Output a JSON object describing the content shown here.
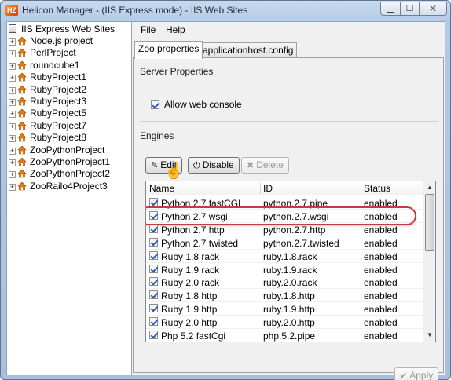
{
  "window": {
    "title": "Helicon Manager - (IIS Express mode) - IIS Web Sites",
    "app_icon_text": "HZ",
    "min_glyph": "▁",
    "max_glyph": "☐",
    "close_glyph": "✕"
  },
  "tree": {
    "root_label": "IIS Express Web Sites",
    "expander_glyph": "+",
    "items": [
      {
        "label": "Node.js project"
      },
      {
        "label": "PerlProject"
      },
      {
        "label": "roundcube1"
      },
      {
        "label": "RubyProject1"
      },
      {
        "label": "RubyProject2"
      },
      {
        "label": "RubyProject3"
      },
      {
        "label": "RubyProject5"
      },
      {
        "label": "RubyProject7"
      },
      {
        "label": "RubyProject8"
      },
      {
        "label": "ZooPythonProject"
      },
      {
        "label": "ZooPythonProject1"
      },
      {
        "label": "ZooPythonProject2"
      },
      {
        "label": "ZooRailo4Project3"
      }
    ]
  },
  "menu": {
    "file": "File",
    "help": "Help"
  },
  "tabs": [
    {
      "label": "Zoo properties",
      "active": true
    },
    {
      "label": "applicationhost.config",
      "active": false
    }
  ],
  "server_properties": {
    "label": "Server Properties",
    "allow_web_console": {
      "label": "Allow web console",
      "checked": true
    }
  },
  "engines": {
    "label": "Engines",
    "buttons": {
      "edit": {
        "label": "Edit",
        "icon": "pencil-icon",
        "glyph": "✎"
      },
      "disable": {
        "label": "Disable",
        "icon": "power-icon",
        "glyph": "⏻"
      },
      "delete": {
        "label": "Delete",
        "icon": "x-icon",
        "glyph": "✖",
        "enabled": false
      }
    },
    "columns": [
      "Name",
      "ID",
      "Status"
    ],
    "rows": [
      {
        "name": "Python 2.7 fastCGI",
        "id": "python.2.7.pipe",
        "status": "enabled",
        "checked": true
      },
      {
        "name": "Python 2.7 wsgi",
        "id": "python.2.7.wsgi",
        "status": "enabled",
        "checked": true,
        "highlighted": true
      },
      {
        "name": "Python 2.7 http",
        "id": "python.2.7.http",
        "status": "enabled",
        "checked": true
      },
      {
        "name": "Python 2.7 twisted",
        "id": "python.2.7.twisted",
        "status": "enabled",
        "checked": true
      },
      {
        "name": "Ruby 1.8 rack",
        "id": "ruby.1.8.rack",
        "status": "enabled",
        "checked": true
      },
      {
        "name": "Ruby 1.9 rack",
        "id": "ruby.1.9.rack",
        "status": "enabled",
        "checked": true
      },
      {
        "name": "Ruby 2.0 rack",
        "id": "ruby.2.0.rack",
        "status": "enabled",
        "checked": true
      },
      {
        "name": "Ruby 1.8 http",
        "id": "ruby.1.8.http",
        "status": "enabled",
        "checked": true
      },
      {
        "name": "Ruby 1.9 http",
        "id": "ruby.1.9.http",
        "status": "enabled",
        "checked": true
      },
      {
        "name": "Ruby 2.0 http",
        "id": "ruby.2.0.http",
        "status": "enabled",
        "checked": true
      },
      {
        "name": "Php 5.2 fastCgi",
        "id": "php.5.2.pipe",
        "status": "enabled",
        "checked": true
      }
    ],
    "scroll_up_glyph": "▲",
    "scroll_down_glyph": "▼"
  },
  "apply": {
    "label": "Apply",
    "glyph": "✔",
    "enabled": false
  },
  "colors": {
    "highlight_ring": "#c43c3c",
    "checkmark": "#2d5cb6",
    "tree_icon": "#e07a10"
  }
}
